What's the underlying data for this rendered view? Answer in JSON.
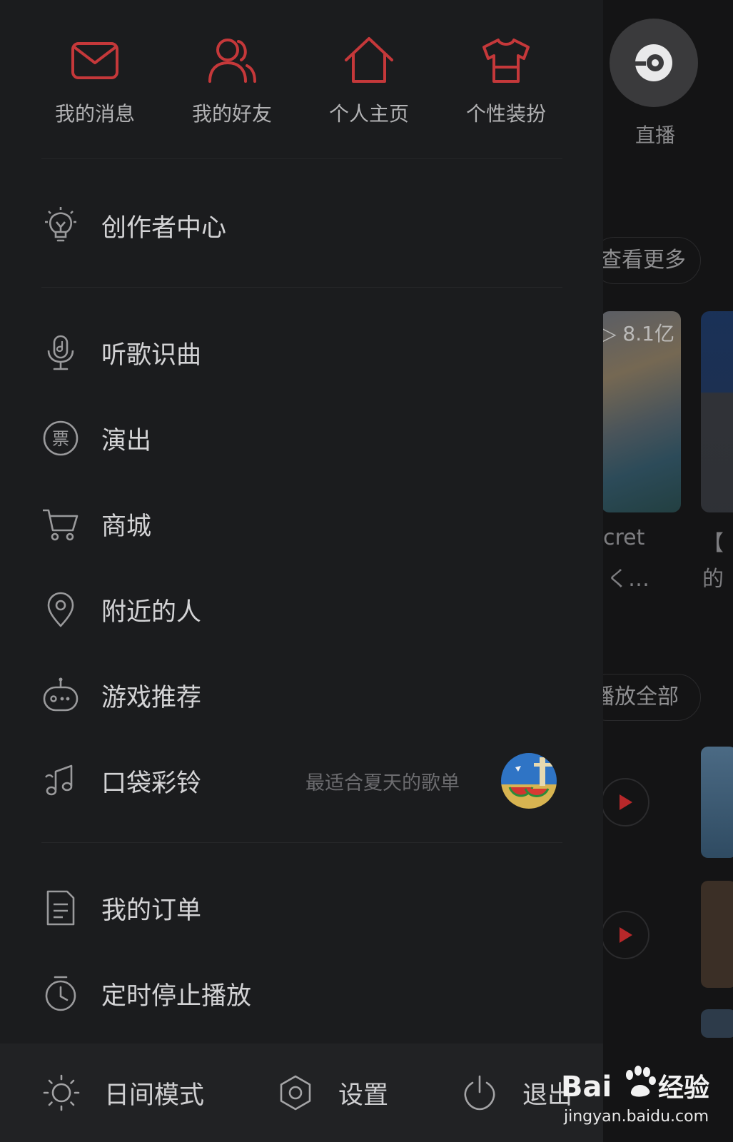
{
  "background": {
    "live_label": "直播",
    "see_more": "查看更多",
    "cover_count": "▷ 8.1亿",
    "song_text_1": "cret",
    "song_text_2": "く…",
    "song_text_3": "【",
    "song_text_4": "的",
    "play_all": "播放全部"
  },
  "quick_actions": [
    {
      "label": "我的消息",
      "icon": "mail-icon"
    },
    {
      "label": "我的好友",
      "icon": "friends-icon"
    },
    {
      "label": "个人主页",
      "icon": "home-icon"
    },
    {
      "label": "个性装扮",
      "icon": "shirt-icon"
    }
  ],
  "menu": {
    "creator_center": "创作者中心",
    "song_recognition": "听歌识曲",
    "shows": "演出",
    "mall": "商城",
    "nearby": "附近的人",
    "games": "游戏推荐",
    "pocket_ringtone": "口袋彩铃",
    "pocket_ringtone_sub": "最适合夏天的歌单",
    "my_orders": "我的订单",
    "sleep_timer": "定时停止播放"
  },
  "footer": {
    "day_mode": "日间模式",
    "settings": "设置",
    "exit": "退出"
  },
  "watermark": {
    "brand": "Bai 经验",
    "url": "jingyan.baidu.com"
  },
  "colors": {
    "accent": "#c5383a",
    "drawer_bg": "#1b1c1e",
    "footer_bg": "#212224",
    "text": "#d3d3d5",
    "muted": "#6c6c6f"
  }
}
